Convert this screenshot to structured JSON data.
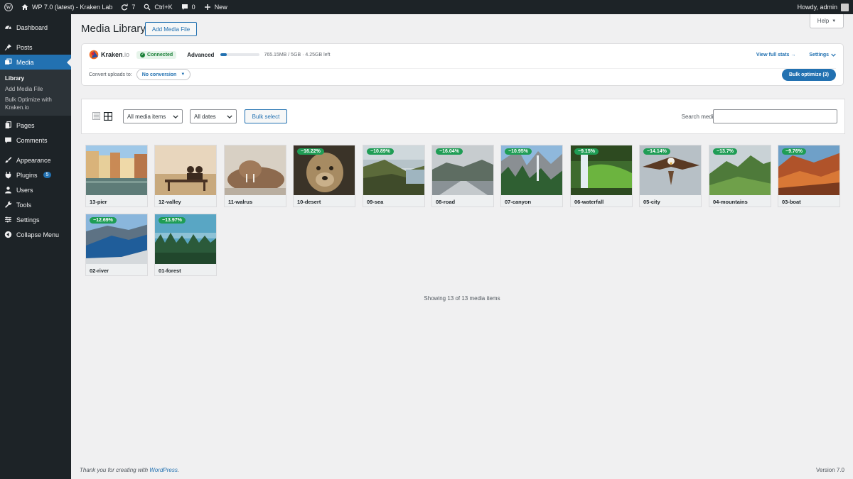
{
  "admin_bar": {
    "site_name": "WP 7.0 (latest) - Kraken Lab",
    "updates_count": "7",
    "search_shortcut": "Ctrl+K",
    "comments_count": "0",
    "new_label": "New",
    "greeting": "Howdy, admin"
  },
  "sidebar": {
    "dashboard": "Dashboard",
    "posts": "Posts",
    "media": "Media",
    "submenu": {
      "library": "Library",
      "add_media_file": "Add Media File",
      "bulk_optimize": "Bulk Optimize with Kraken.io"
    },
    "pages": "Pages",
    "comments": "Comments",
    "appearance": "Appearance",
    "plugins": "Plugins",
    "plugins_badge": "5",
    "users": "Users",
    "tools": "Tools",
    "settings": "Settings",
    "collapse": "Collapse Menu"
  },
  "header": {
    "title": "Media Library",
    "add_button": "Add Media File",
    "help": "Help"
  },
  "kraken": {
    "logo_main": "Kraken",
    "logo_suffix": ".io",
    "status": "Connected",
    "plan": "Advanced",
    "usage_fraction": 0.15,
    "usage_text": "765.15MB / 5GB · 4.25GB left",
    "view_stats": "View full stats →",
    "settings": "Settings",
    "convert_label": "Convert uploads to:",
    "convert_value": "No conversion",
    "bulk_optimize": "Bulk optimize (3)"
  },
  "toolbar": {
    "type_filter": "All media items",
    "date_filter": "All dates",
    "bulk_select": "Bulk select",
    "search_label": "Search media",
    "search_value": ""
  },
  "media": [
    {
      "name": "13-pier",
      "saving": "",
      "theme": "pier"
    },
    {
      "name": "12-valley",
      "saving": "",
      "theme": "valley"
    },
    {
      "name": "11-walrus",
      "saving": "",
      "theme": "walrus"
    },
    {
      "name": "10-desert",
      "saving": "−16.22%",
      "theme": "desert"
    },
    {
      "name": "09-sea",
      "saving": "−10.89%",
      "theme": "sea"
    },
    {
      "name": "08-road",
      "saving": "−16.04%",
      "theme": "road"
    },
    {
      "name": "07-canyon",
      "saving": "−10.95%",
      "theme": "canyon"
    },
    {
      "name": "06-waterfall",
      "saving": "−9.15%",
      "theme": "waterfall"
    },
    {
      "name": "05-city",
      "saving": "−14.14%",
      "theme": "city"
    },
    {
      "name": "04-mountains",
      "saving": "−13.7%",
      "theme": "mountains"
    },
    {
      "name": "03-boat",
      "saving": "−9.76%",
      "theme": "boat"
    },
    {
      "name": "02-river",
      "saving": "−12.69%",
      "theme": "river"
    },
    {
      "name": "01-forest",
      "saving": "−13.97%",
      "theme": "forest"
    }
  ],
  "showing_text": "Showing 13 of 13 media items",
  "footer": {
    "thanks_prefix": "Thank you for creating with ",
    "wordpress_link": "WordPress",
    "thanks_suffix": ".",
    "version": "Version 7.0"
  }
}
